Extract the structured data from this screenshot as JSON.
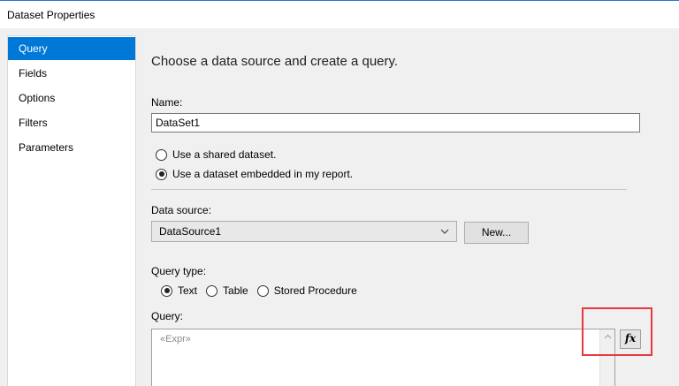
{
  "window": {
    "title": "Dataset Properties"
  },
  "nav": {
    "items": [
      {
        "label": "Query",
        "selected": true
      },
      {
        "label": "Fields",
        "selected": false
      },
      {
        "label": "Options",
        "selected": false
      },
      {
        "label": "Filters",
        "selected": false
      },
      {
        "label": "Parameters",
        "selected": false
      }
    ]
  },
  "main": {
    "heading": "Choose a data source and create a query.",
    "name_label": "Name:",
    "name_value": "DataSet1",
    "dataset_options": {
      "shared": "Use a shared dataset.",
      "embedded": "Use a dataset embedded in my report.",
      "selected": "embedded"
    },
    "data_source_label": "Data source:",
    "data_source_value": "DataSource1",
    "new_button": "New...",
    "query_type_label": "Query type:",
    "query_types": {
      "text": "Text",
      "table": "Table",
      "stored_procedure": "Stored Procedure",
      "selected": "text"
    },
    "query_label": "Query:",
    "query_value": "«Expr»",
    "fx_label": "fx"
  },
  "colors": {
    "accent": "#0078d7",
    "highlight": "#e8383d"
  },
  "icons": {
    "combo": "chevron-down-icon",
    "scroll": "scroll-up-arrow-icon"
  }
}
